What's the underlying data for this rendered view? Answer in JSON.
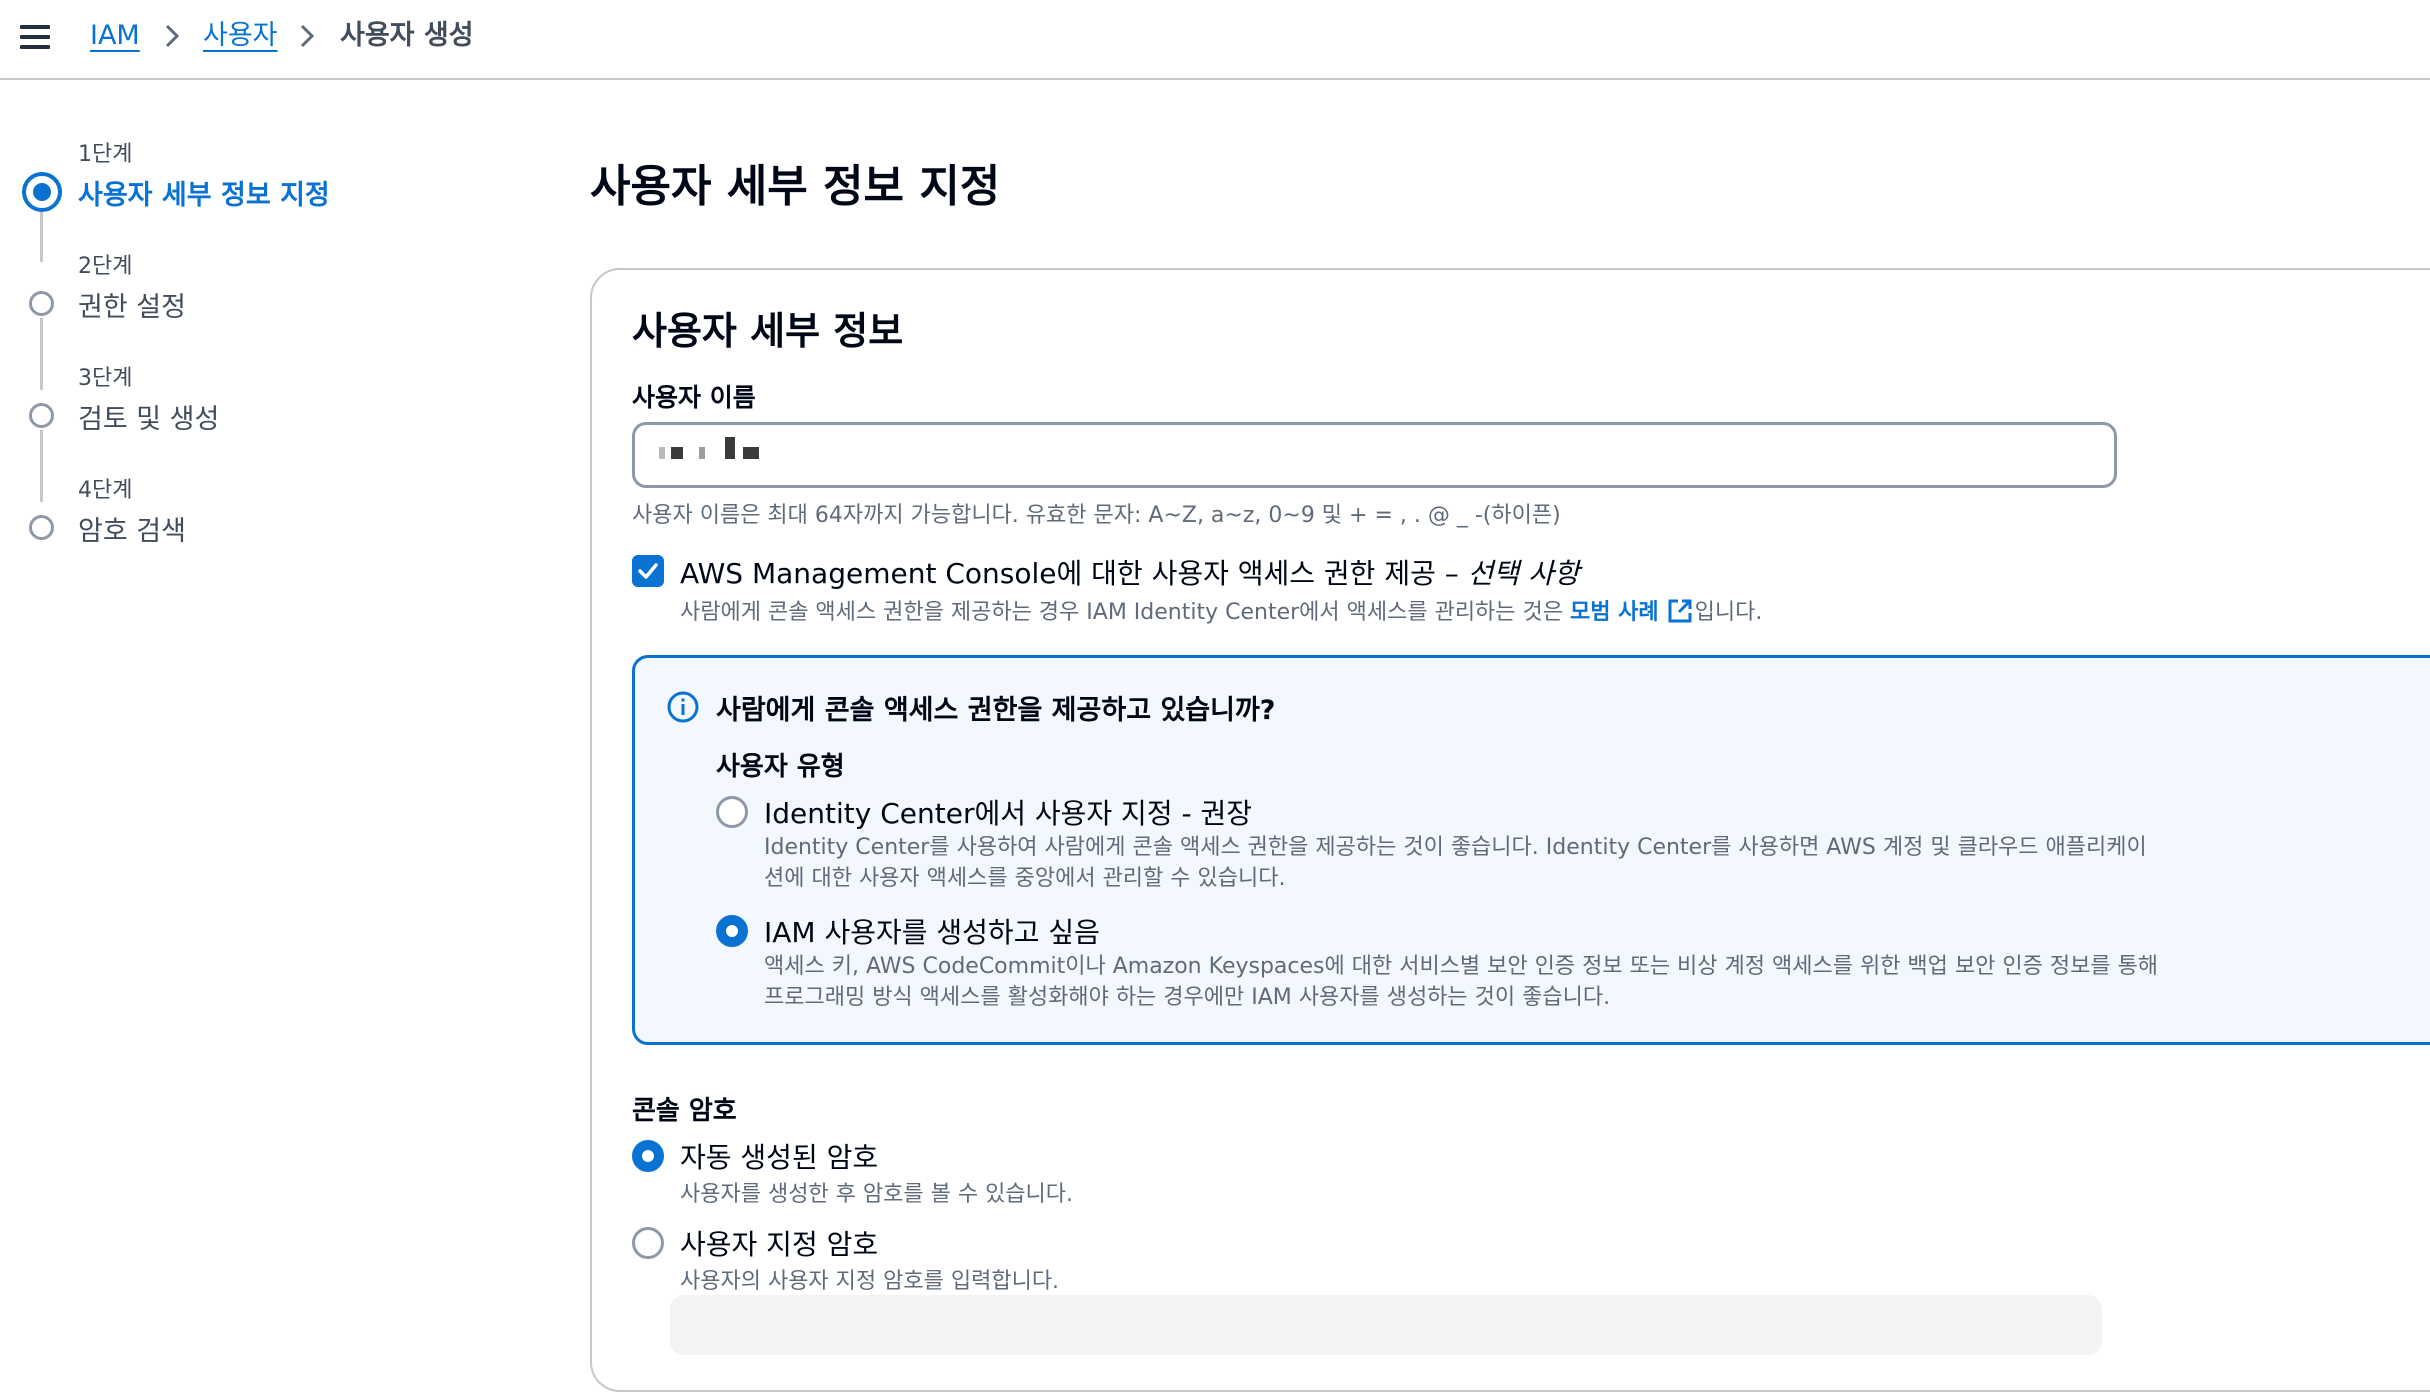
{
  "header": {
    "breadcrumbs": [
      {
        "label": "IAM"
      },
      {
        "label": "사용자"
      },
      {
        "label": "사용자 생성"
      }
    ]
  },
  "steps": [
    {
      "step": "1단계",
      "title": "사용자 세부 정보 지정",
      "active": true
    },
    {
      "step": "2단계",
      "title": "권한 설정",
      "active": false
    },
    {
      "step": "3단계",
      "title": "검토 및 생성",
      "active": false
    },
    {
      "step": "4단계",
      "title": "암호 검색",
      "active": false
    }
  ],
  "page": {
    "title": "사용자 세부 정보 지정"
  },
  "details": {
    "card_title": "사용자 세부 정보",
    "username_label": "사용자 이름",
    "username_hint": "사용자 이름은 최대 64자까지 가능합니다. 유효한 문자: A~Z, a~z, 0~9 및 + = , . @ _ -(하이픈)",
    "console_access": {
      "checked": true,
      "label": "AWS Management Console에 대한 사용자 액세스 권한 제공 – ",
      "label_optional": "선택 사항",
      "desc_before": "사람에게 콘솔 액세스 권한을 제공하는 경우 IAM Identity Center에서 액세스를 관리하는 것은 ",
      "desc_link": "모범 사례",
      "desc_after": "입니다."
    }
  },
  "alert": {
    "title": "사람에게 콘솔 액세스 권한을 제공하고 있습니까?",
    "user_type_label": "사용자 유형",
    "options": [
      {
        "label": "Identity Center에서 사용자 지정 - 권장",
        "desc": "Identity Center를 사용하여 사람에게 콘솔 액세스 권한을 제공하는 것이 좋습니다. Identity Center를 사용하면 AWS 계정 및 클라우드 애플리케이션에 대한 사용자 액세스를 중앙에서 관리할 수 있습니다.",
        "checked": false
      },
      {
        "label": "IAM 사용자를 생성하고 싶음",
        "desc": "액세스 키, AWS CodeCommit이나 Amazon Keyspaces에 대한 서비스별 보안 인증 정보 또는 비상 계정 액세스를 위한 백업 보안 인증 정보를 통해 프로그래밍 방식 액세스를 활성화해야 하는 경우에만 IAM 사용자를 생성하는 것이 좋습니다.",
        "checked": true
      }
    ]
  },
  "password": {
    "label": "콘솔 암호",
    "options": [
      {
        "label": "자동 생성된 암호",
        "desc": "사용자를 생성한 후 암호를 볼 수 있습니다.",
        "checked": true
      },
      {
        "label": "사용자 지정 암호",
        "desc": "사용자의 사용자 지정 암호를 입력합니다.",
        "checked": false
      }
    ]
  },
  "colors": {
    "accent": "#0972d3",
    "alert_bg": "#f2f8fd",
    "border": "#c6c6cd",
    "muted_text": "#5f6b7a"
  }
}
